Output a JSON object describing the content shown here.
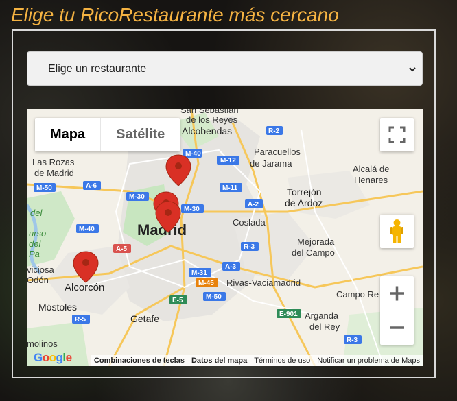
{
  "page": {
    "title": "Elige tu RicoRestaurante más cercano"
  },
  "restaurant_select": {
    "selected": "Elige un restaurante"
  },
  "map": {
    "type_buttons": [
      "Mapa",
      "Satélite"
    ],
    "labels": {
      "san_sebastian": "San Sebastián",
      "de_los_reyes": "de los Reyes",
      "alcobendas": "Alcobendas",
      "las_rozas": "Las Rozas",
      "de_madrid": "de Madrid",
      "paracuellos": "Paracuellos",
      "de_jarama": "de Jarama",
      "alcala": "Alcalá de",
      "henares": "Henares",
      "torrejon": "Torrejón",
      "de_ardoz": "de Ardoz",
      "madrid": "Madrid",
      "coslada": "Coslada",
      "mejorada": "Mejorada",
      "del_campo": "del Campo",
      "viciosa": "viciosa",
      "odon": "Odón",
      "alcorcon": "Alcorcón",
      "rivas": "Rivas-Vaciamadrid",
      "campo_real": "Campo Re",
      "mostoles": "Móstoles",
      "getafe": "Getafe",
      "arganda": "Arganda",
      "del_rey": "del Rey",
      "molinos": "molinos",
      "manzanares_1": "del",
      "manzanares_2": "urso",
      "manzanares_3": "del",
      "manzanares_4": "Pa"
    },
    "roads": [
      "M-40",
      "M-12",
      "R-2",
      "M-50",
      "A-6",
      "M-11",
      "M-30",
      "M-30",
      "A-2",
      "M-40",
      "A-5",
      "R-3",
      "M-31",
      "A-3",
      "M-45",
      "M-50",
      "E-5",
      "E-901",
      "R-5",
      "R-3"
    ],
    "attribution": {
      "google": "Google",
      "shortcuts": "Combinaciones de teclas",
      "map_data": "Datos del mapa",
      "terms": "Términos de uso",
      "report": "Notificar un problema de Maps"
    }
  },
  "icons": {
    "chevron": "chevron-down-icon",
    "fullscreen": "fullscreen-icon",
    "pegman": "pegman-icon",
    "zoom_in": "plus-icon",
    "zoom_out": "minus-icon",
    "marker": "map-marker-icon"
  },
  "colors": {
    "title": "#f5b342",
    "marker": "#d93025",
    "road_badge": "#3b78e7",
    "road_badge_alt": "#e8820c",
    "road_badge_green": "#2e8b57",
    "road_badge_red": "#d9534f"
  }
}
